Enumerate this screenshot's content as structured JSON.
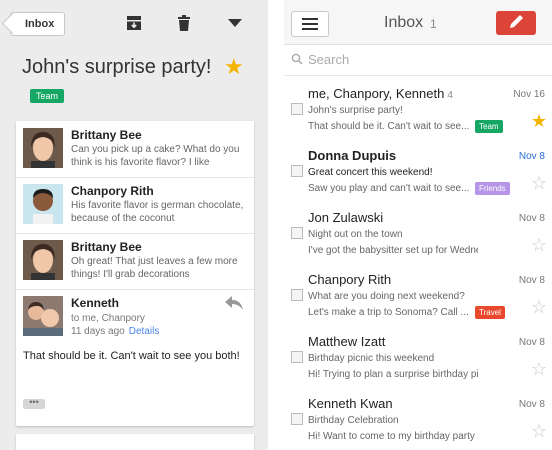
{
  "thread": {
    "back_label": "Inbox",
    "subject": "John's surprise party!",
    "label": "Team",
    "label_color": "#16a765",
    "messages": [
      {
        "sender": "Brittany Bee",
        "snippet": "Can you pick up a cake? What do you think is his favorite flavor? I like"
      },
      {
        "sender": "Chanpory Rith",
        "snippet": "His favorite flavor is german chocolate, because of the coconut"
      },
      {
        "sender": "Brittany Bee",
        "snippet": "Oh great! That just leaves a few more things! I'll grab decorations"
      }
    ],
    "expanded": {
      "sender": "Kenneth",
      "to": "to me, Chanpory",
      "time": "11 days ago",
      "details_link": "Details",
      "body": "That should be it. Can't wait to see you both!",
      "more": "•••"
    }
  },
  "inbox": {
    "title": "Inbox",
    "count": "1",
    "search_placeholder": "Search",
    "accent": "#db4437",
    "rows": [
      {
        "sender": "me, Chanpory, Kenneth",
        "count": "4",
        "date": "Nov 16",
        "subject": "John's surprise party!",
        "snippet": "That should be it. Can't wait to see...",
        "label": "Team",
        "label_color": "#16a765",
        "starred": true,
        "unread": false
      },
      {
        "sender": "Donna Dupuis",
        "count": "",
        "date": "Nov 8",
        "subject": "Great concert this weekend!",
        "snippet": "Saw you play and can't wait to see...",
        "label": "Friends",
        "label_color": "#b694e8",
        "starred": false,
        "unread": true
      },
      {
        "sender": "Jon Zulawski",
        "count": "",
        "date": "Nov 8",
        "subject": "Night out on the town",
        "snippet": "I've got the babysitter set up for Wednes...",
        "label": "",
        "label_color": "",
        "starred": false,
        "unread": false
      },
      {
        "sender": "Chanpory Rith",
        "count": "",
        "date": "Nov 8",
        "subject": "What are you doing next weekend?",
        "snippet": "Let's make a trip to Sonoma? Call ...",
        "label": "Travel",
        "label_color": "#e8492c",
        "starred": false,
        "unread": false
      },
      {
        "sender": "Matthew Izatt",
        "count": "",
        "date": "Nov 8",
        "subject": "Birthday picnic this weekend",
        "snippet": "Hi! Trying to plan a surprise birthday picnic...",
        "label": "",
        "label_color": "",
        "starred": false,
        "unread": false
      },
      {
        "sender": "Kenneth Kwan",
        "count": "",
        "date": "Nov 8",
        "subject": "Birthday Celebration",
        "snippet": "Hi! Want to come to my birthday party this...",
        "label": "",
        "label_color": "",
        "starred": false,
        "unread": false
      }
    ]
  }
}
